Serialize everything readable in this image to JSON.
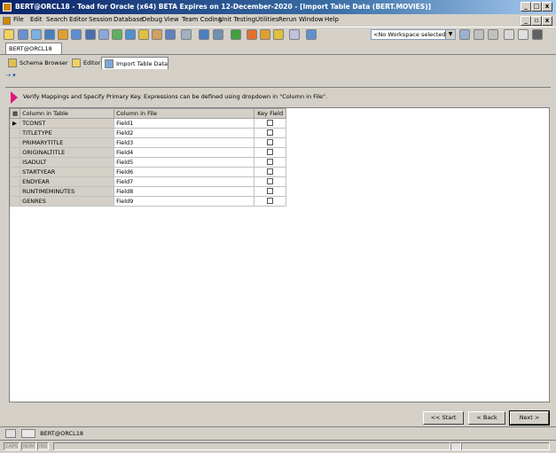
{
  "window": {
    "title": "BERT@ORCL18 - Toad for Oracle (x64)  BETA Expires on 12-December-2020 - [Import Table Data (BERT.MOVIES)]",
    "controls": [
      "_",
      "□",
      "x"
    ],
    "child_controls": [
      "_",
      "▫",
      "x"
    ]
  },
  "menu": [
    "File",
    "Edit",
    "Search",
    "Editor",
    "Session",
    "Database",
    "Debug",
    "View",
    "Team Coding",
    "Unit Testing",
    "Utilities",
    "Rerun",
    "Window",
    "Help"
  ],
  "toolbar": {
    "workspace_combo": "<No Workspace selected>",
    "combo_arrow": "▼"
  },
  "session_tab": "BERT@ORCL18",
  "subtabs": [
    "Schema Browser",
    "Editor",
    "Import Table Data"
  ],
  "mini_toolbar": "⇢ ▾",
  "hint": "Verify Mappings and Specify Primary Key.  Expressions can be defined using dropdown in \"Column in File\".",
  "grid": {
    "headers": [
      "Column in Table",
      "Column in File",
      "Key Field"
    ],
    "rows": [
      {
        "table_col": "TCONST",
        "file_col": "Field1"
      },
      {
        "table_col": "TITLETYPE",
        "file_col": "Field2"
      },
      {
        "table_col": "PRIMARYTITLE",
        "file_col": "Field3"
      },
      {
        "table_col": "ORIGINALTITLE",
        "file_col": "Field4"
      },
      {
        "table_col": "ISADULT",
        "file_col": "Field5"
      },
      {
        "table_col": "STARTYEAR",
        "file_col": "Field6"
      },
      {
        "table_col": "ENDYEAR",
        "file_col": "Field7"
      },
      {
        "table_col": "RUNTIMEMINUTES",
        "file_col": "Field8"
      },
      {
        "table_col": "GENRES",
        "file_col": "Field9"
      }
    ],
    "current_row_marker": "▶"
  },
  "buttons": {
    "start": "<< Start",
    "back": "< Back",
    "next": "Next >"
  },
  "taskbar": {
    "session": "BERT@ORCL18"
  },
  "status": [
    "CAPS",
    "NUM",
    "INS"
  ]
}
